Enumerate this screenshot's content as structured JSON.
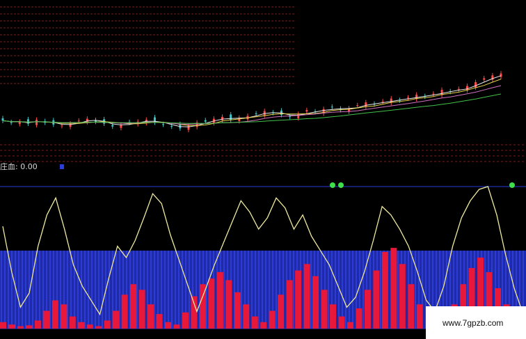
{
  "indicator": {
    "label": "庄血: 0.00"
  },
  "watermark": {
    "text": "www.7gpzb.com"
  },
  "colors": {
    "background": "#000000",
    "grid": "#7a1f1f",
    "candle_up": "#ff4a4a",
    "candle_down": "#3fc5c5",
    "ma_white": "#e8e8e8",
    "ma_yellow": "#e6d24a",
    "ma_pink": "#d070c0",
    "ma_green": "#42c24a",
    "baseline": "#2a3dd8",
    "hist_blue": "#1e2aa8",
    "hist_line": "#3a4dff",
    "osc_line": "#f0eaa0",
    "bars_red": "#e8183a",
    "signal_green": "#3ee04a"
  },
  "chart_data": [
    {
      "type": "candlestick",
      "title": "",
      "closes": [
        10.2,
        10.0,
        10.1,
        9.9,
        10.3,
        10.0,
        9.8,
        9.7,
        9.9,
        10.2,
        10.4,
        10.1,
        9.9,
        9.6,
        9.8,
        10.0,
        10.1,
        10.3,
        10.0,
        9.8,
        9.6,
        9.4,
        9.7,
        10.0,
        10.1,
        10.4,
        10.6,
        10.3,
        10.5,
        10.7,
        10.9,
        11.2,
        11.0,
        10.8,
        10.6,
        10.9,
        11.3,
        11.1,
        11.4,
        11.6,
        11.3,
        11.5,
        11.8,
        12.1,
        11.9,
        12.2,
        12.5,
        12.3,
        12.6,
        12.9,
        12.7,
        13.0,
        13.4,
        13.2,
        13.5,
        13.8,
        14.2,
        14.6,
        14.9,
        15.1
      ],
      "ylim": [
        9.0,
        15.5
      ],
      "ma_series": [
        "white",
        "yellow",
        "pink",
        "green"
      ]
    },
    {
      "type": "line",
      "title": "庄血",
      "value": 0.0,
      "oscillator": [
        72,
        40,
        15,
        25,
        58,
        80,
        92,
        70,
        45,
        30,
        20,
        10,
        35,
        58,
        50,
        62,
        78,
        95,
        88,
        66,
        48,
        30,
        12,
        28,
        45,
        60,
        75,
        90,
        82,
        70,
        78,
        92,
        85,
        70,
        80,
        65,
        55,
        45,
        30,
        15,
        22,
        40,
        62,
        86,
        80,
        70,
        58,
        40,
        20,
        12,
        30,
        58,
        78,
        90,
        98,
        100,
        80,
        52,
        28,
        10
      ],
      "ylim": [
        0,
        100
      ]
    },
    {
      "type": "bar",
      "title": "",
      "red_bars": [
        8,
        5,
        3,
        4,
        10,
        22,
        35,
        30,
        15,
        8,
        5,
        3,
        10,
        22,
        42,
        55,
        48,
        30,
        18,
        8,
        5,
        20,
        40,
        55,
        62,
        70,
        60,
        45,
        30,
        15,
        8,
        22,
        42,
        60,
        72,
        80,
        65,
        48,
        30,
        15,
        8,
        25,
        48,
        72,
        95,
        100,
        80,
        55,
        30,
        12,
        5,
        15,
        30,
        55,
        75,
        88,
        70,
        50,
        30,
        20
      ],
      "ylim": [
        0,
        100
      ]
    }
  ]
}
